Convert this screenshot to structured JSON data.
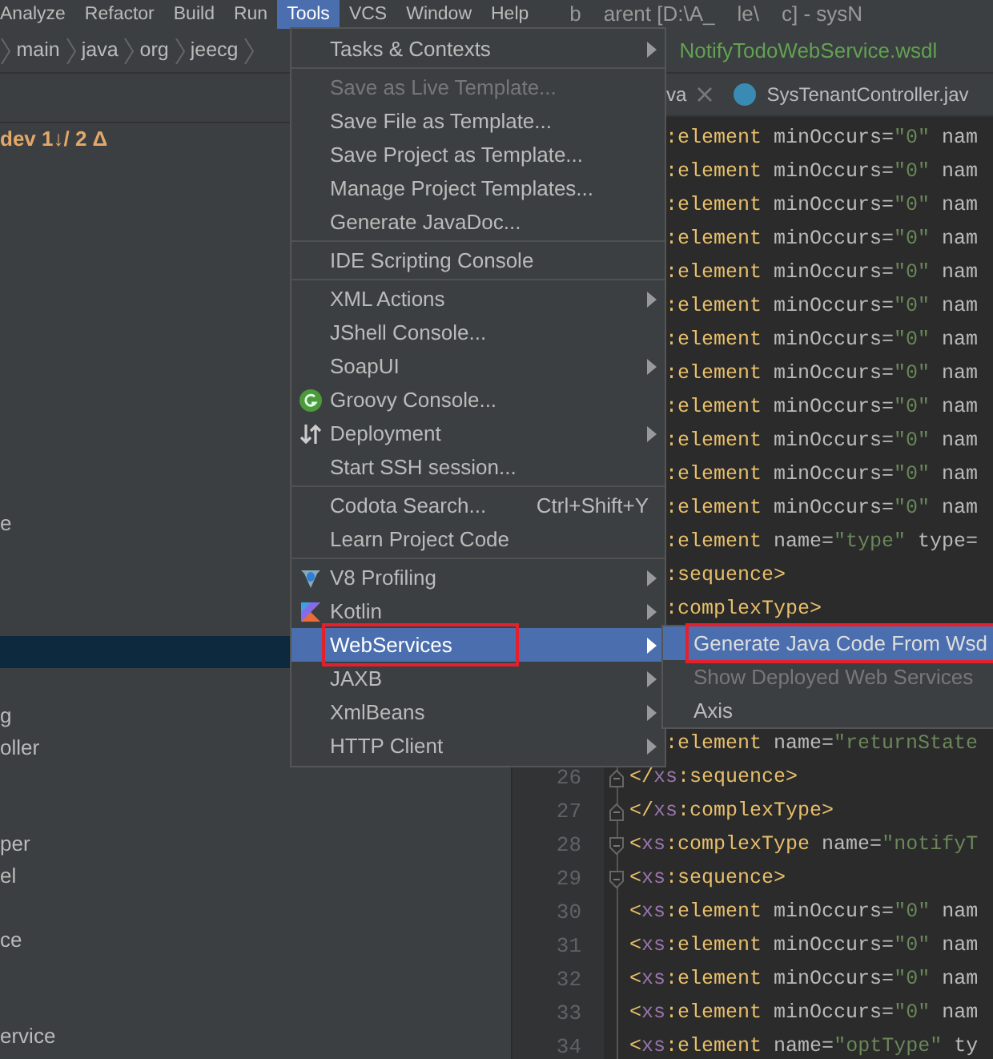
{
  "menubar": {
    "menus": [
      {
        "label": "Analyze",
        "selected": false
      },
      {
        "label": "Refactor",
        "selected": false
      },
      {
        "label": "Build",
        "selected": false
      },
      {
        "label": "Run",
        "selected": false
      },
      {
        "label": "Tools",
        "selected": true
      },
      {
        "label": "VCS",
        "selected": false
      },
      {
        "label": "Window",
        "selected": false
      },
      {
        "label": "Help",
        "selected": false
      }
    ],
    "title_fragments": [
      "b",
      "arent [D:\\A_",
      "le\\",
      "c] - sysN"
    ]
  },
  "breadcrumbs": {
    "items": [
      "main",
      "java",
      "org",
      "jeecg"
    ],
    "file": "NotifyTodoWebService.wsdl"
  },
  "project_tree": {
    "rows": [
      {
        "kind": "text",
        "text": "dev 1↓/ 2 Δ",
        "selected": false
      },
      {
        "kind": "covered",
        "selected": false
      },
      {
        "kind": "covered",
        "selected": false
      },
      {
        "kind": "covered",
        "selected": false
      },
      {
        "kind": "covered",
        "selected": false
      },
      {
        "kind": "covered",
        "selected": false
      },
      {
        "kind": "covered",
        "selected": false
      },
      {
        "kind": "covered",
        "selected": false
      },
      {
        "kind": "covered",
        "selected": false
      },
      {
        "kind": "covered",
        "selected": false
      },
      {
        "kind": "covered",
        "selected": false
      },
      {
        "kind": "covered",
        "selected": false
      },
      {
        "kind": "text",
        "text": "e",
        "selected": false
      },
      {
        "kind": "covered",
        "selected": false
      },
      {
        "kind": "covered",
        "selected": false
      },
      {
        "kind": "covered",
        "selected": false
      },
      {
        "kind": "covered",
        "selected": true
      },
      {
        "kind": "covered",
        "selected": false
      },
      {
        "kind": "text",
        "text": "g",
        "selected": false
      },
      {
        "kind": "text",
        "text": "oller",
        "selected": false
      },
      {
        "kind": "covered",
        "selected": false
      },
      {
        "kind": "covered",
        "selected": false
      },
      {
        "kind": "text",
        "text": "per",
        "selected": false
      },
      {
        "kind": "text",
        "text": "el",
        "selected": false
      },
      {
        "kind": "covered",
        "selected": false
      },
      {
        "kind": "text",
        "text": "ce",
        "selected": false
      },
      {
        "kind": "covered",
        "selected": false
      },
      {
        "kind": "covered",
        "selected": false
      },
      {
        "kind": "text",
        "text": "ervice",
        "selected": false
      }
    ]
  },
  "editor_tabs": [
    {
      "label": "va",
      "closable": true,
      "class_icon": false
    },
    {
      "label": "SysTenantController.jav",
      "closable": false,
      "class_icon": true
    }
  ],
  "code_lines": [
    {
      "kind": "partial",
      "segments": [
        {
          "kind": "tag",
          "text": ":element"
        },
        {
          "kind": "attr",
          "text": " minOccurs="
        },
        {
          "kind": "value",
          "text": "\"0\""
        },
        {
          "kind": "attr",
          "text": " nam"
        }
      ]
    },
    {
      "kind": "partial",
      "segments": [
        {
          "kind": "tag",
          "text": ":element"
        },
        {
          "kind": "attr",
          "text": " minOccurs="
        },
        {
          "kind": "value",
          "text": "\"0\""
        },
        {
          "kind": "attr",
          "text": " nam"
        }
      ]
    },
    {
      "kind": "partial",
      "segments": [
        {
          "kind": "tag",
          "text": ":element"
        },
        {
          "kind": "attr",
          "text": " minOccurs="
        },
        {
          "kind": "value",
          "text": "\"0\""
        },
        {
          "kind": "attr",
          "text": " nam"
        }
      ]
    },
    {
      "kind": "partial",
      "segments": [
        {
          "kind": "tag",
          "text": ":element"
        },
        {
          "kind": "attr",
          "text": " minOccurs="
        },
        {
          "kind": "value",
          "text": "\"0\""
        },
        {
          "kind": "attr",
          "text": " nam"
        }
      ]
    },
    {
      "kind": "partial",
      "segments": [
        {
          "kind": "tag",
          "text": ":element"
        },
        {
          "kind": "attr",
          "text": " minOccurs="
        },
        {
          "kind": "value",
          "text": "\"0\""
        },
        {
          "kind": "attr",
          "text": " nam"
        }
      ]
    },
    {
      "kind": "partial",
      "segments": [
        {
          "kind": "tag",
          "text": ":element"
        },
        {
          "kind": "attr",
          "text": " minOccurs="
        },
        {
          "kind": "value",
          "text": "\"0\""
        },
        {
          "kind": "attr",
          "text": " nam"
        }
      ]
    },
    {
      "kind": "partial",
      "segments": [
        {
          "kind": "tag",
          "text": ":element"
        },
        {
          "kind": "attr",
          "text": " minOccurs="
        },
        {
          "kind": "value",
          "text": "\"0\""
        },
        {
          "kind": "attr",
          "text": " nam"
        }
      ]
    },
    {
      "kind": "partial",
      "segments": [
        {
          "kind": "tag",
          "text": ":element"
        },
        {
          "kind": "attr",
          "text": " minOccurs="
        },
        {
          "kind": "value",
          "text": "\"0\""
        },
        {
          "kind": "attr",
          "text": " nam"
        }
      ]
    },
    {
      "kind": "partial",
      "segments": [
        {
          "kind": "tag",
          "text": ":element"
        },
        {
          "kind": "attr",
          "text": " minOccurs="
        },
        {
          "kind": "value",
          "text": "\"0\""
        },
        {
          "kind": "attr",
          "text": " nam"
        }
      ]
    },
    {
      "kind": "partial",
      "segments": [
        {
          "kind": "tag",
          "text": ":element"
        },
        {
          "kind": "attr",
          "text": " minOccurs="
        },
        {
          "kind": "value",
          "text": "\"0\""
        },
        {
          "kind": "attr",
          "text": " nam"
        }
      ]
    },
    {
      "kind": "partial",
      "segments": [
        {
          "kind": "tag",
          "text": ":element"
        },
        {
          "kind": "attr",
          "text": " minOccurs="
        },
        {
          "kind": "value",
          "text": "\"0\""
        },
        {
          "kind": "attr",
          "text": " nam"
        }
      ]
    },
    {
      "kind": "partial",
      "segments": [
        {
          "kind": "tag",
          "text": ":element"
        },
        {
          "kind": "attr",
          "text": " minOccurs="
        },
        {
          "kind": "value",
          "text": "\"0\""
        },
        {
          "kind": "attr",
          "text": " nam"
        }
      ]
    },
    {
      "kind": "partial",
      "segments": [
        {
          "kind": "tag",
          "text": ":element"
        },
        {
          "kind": "attr",
          "text": " name="
        },
        {
          "kind": "value",
          "text": "\"type\""
        },
        {
          "kind": "attr",
          "text": " type="
        }
      ]
    },
    {
      "kind": "partial",
      "segments": [
        {
          "kind": "tag",
          "text": ":sequence>"
        }
      ]
    },
    {
      "kind": "partial",
      "segments": [
        {
          "kind": "tag",
          "text": ":complexType>"
        }
      ]
    },
    {
      "kind": "covered"
    },
    {
      "kind": "covered"
    },
    {
      "kind": "covered"
    },
    {
      "kind": "partial",
      "segments": [
        {
          "kind": "tag",
          "text": ":element"
        },
        {
          "kind": "attr",
          "text": " name="
        },
        {
          "kind": "value",
          "text": "\"returnState"
        }
      ]
    },
    {
      "kind": "full",
      "number": "26",
      "fold_end": true,
      "segments": [
        {
          "kind": "tag",
          "text": "</"
        },
        {
          "kind": "ns",
          "text": "xs"
        },
        {
          "kind": "tag",
          "text": ":sequence>"
        }
      ]
    },
    {
      "kind": "full",
      "number": "27",
      "fold_end": true,
      "segments": [
        {
          "kind": "tag",
          "text": "</"
        },
        {
          "kind": "ns",
          "text": "xs"
        },
        {
          "kind": "tag",
          "text": ":complexType>"
        }
      ]
    },
    {
      "kind": "full",
      "number": "28",
      "fold_start": true,
      "segments": [
        {
          "kind": "tag",
          "text": "<"
        },
        {
          "kind": "ns",
          "text": "xs"
        },
        {
          "kind": "tag",
          "text": ":complexType"
        },
        {
          "kind": "attr",
          "text": " name="
        },
        {
          "kind": "value",
          "text": "\"notifyT"
        }
      ]
    },
    {
      "kind": "full",
      "number": "29",
      "fold_start": true,
      "segments": [
        {
          "kind": "tag",
          "text": "<"
        },
        {
          "kind": "ns",
          "text": "xs"
        },
        {
          "kind": "tag",
          "text": ":sequence>"
        }
      ]
    },
    {
      "kind": "full",
      "number": "30",
      "segments": [
        {
          "kind": "tag",
          "text": "<"
        },
        {
          "kind": "ns",
          "text": "xs"
        },
        {
          "kind": "tag",
          "text": ":element"
        },
        {
          "kind": "attr",
          "text": " minOccurs="
        },
        {
          "kind": "value",
          "text": "\"0\""
        },
        {
          "kind": "attr",
          "text": " nam"
        }
      ]
    },
    {
      "kind": "full",
      "number": "31",
      "segments": [
        {
          "kind": "tag",
          "text": "<"
        },
        {
          "kind": "ns",
          "text": "xs"
        },
        {
          "kind": "tag",
          "text": ":element"
        },
        {
          "kind": "attr",
          "text": " minOccurs="
        },
        {
          "kind": "value",
          "text": "\"0\""
        },
        {
          "kind": "attr",
          "text": " nam"
        }
      ]
    },
    {
      "kind": "full",
      "number": "32",
      "segments": [
        {
          "kind": "tag",
          "text": "<"
        },
        {
          "kind": "ns",
          "text": "xs"
        },
        {
          "kind": "tag",
          "text": ":element"
        },
        {
          "kind": "attr",
          "text": " minOccurs="
        },
        {
          "kind": "value",
          "text": "\"0\""
        },
        {
          "kind": "attr",
          "text": " nam"
        }
      ]
    },
    {
      "kind": "full",
      "number": "33",
      "segments": [
        {
          "kind": "tag",
          "text": "<"
        },
        {
          "kind": "ns",
          "text": "xs"
        },
        {
          "kind": "tag",
          "text": ":element"
        },
        {
          "kind": "attr",
          "text": " minOccurs="
        },
        {
          "kind": "value",
          "text": "\"0\""
        },
        {
          "kind": "attr",
          "text": " nam"
        }
      ]
    },
    {
      "kind": "full",
      "number": "34",
      "segments": [
        {
          "kind": "tag",
          "text": "<"
        },
        {
          "kind": "ns",
          "text": "xs"
        },
        {
          "kind": "tag",
          "text": ":element"
        },
        {
          "kind": "attr",
          "text": " name="
        },
        {
          "kind": "value",
          "text": "\"optType\""
        },
        {
          "kind": "attr",
          "text": " ty"
        }
      ]
    }
  ],
  "tools_menu": [
    {
      "kind": "item",
      "label": "Tasks & Contexts",
      "submenu": true,
      "disabled": false,
      "selected": false,
      "boxed": false,
      "has_icon": false
    },
    {
      "kind": "separator"
    },
    {
      "kind": "item",
      "label": "Save as Live Template...",
      "submenu": false,
      "disabled": true,
      "selected": false,
      "boxed": false,
      "has_icon": false
    },
    {
      "kind": "item",
      "label": "Save File as Template...",
      "submenu": false,
      "disabled": false,
      "selected": false,
      "boxed": false,
      "has_icon": false
    },
    {
      "kind": "item",
      "label": "Save Project as Template...",
      "submenu": false,
      "disabled": false,
      "selected": false,
      "boxed": false,
      "has_icon": false
    },
    {
      "kind": "item",
      "label": "Manage Project Templates...",
      "submenu": false,
      "disabled": false,
      "selected": false,
      "boxed": false,
      "has_icon": false
    },
    {
      "kind": "item",
      "label": "Generate JavaDoc...",
      "submenu": false,
      "disabled": false,
      "selected": false,
      "boxed": false,
      "has_icon": false
    },
    {
      "kind": "separator"
    },
    {
      "kind": "item",
      "label": "IDE Scripting Console",
      "submenu": false,
      "disabled": false,
      "selected": false,
      "boxed": false,
      "has_icon": false
    },
    {
      "kind": "separator"
    },
    {
      "kind": "item",
      "label": "XML Actions",
      "submenu": true,
      "disabled": false,
      "selected": false,
      "boxed": false,
      "has_icon": false
    },
    {
      "kind": "item",
      "label": "JShell Console...",
      "submenu": false,
      "disabled": false,
      "selected": false,
      "boxed": false,
      "has_icon": false
    },
    {
      "kind": "item",
      "label": "SoapUI",
      "submenu": true,
      "disabled": false,
      "selected": false,
      "boxed": false,
      "has_icon": false
    },
    {
      "kind": "item",
      "label": "Groovy Console...",
      "submenu": false,
      "disabled": false,
      "selected": false,
      "boxed": false,
      "has_icon": true
    },
    {
      "kind": "item",
      "label": "Deployment",
      "submenu": true,
      "disabled": false,
      "selected": false,
      "boxed": false,
      "has_icon": true
    },
    {
      "kind": "item",
      "label": "Start SSH session...",
      "submenu": false,
      "disabled": false,
      "selected": false,
      "boxed": false,
      "has_icon": false
    },
    {
      "kind": "separator"
    },
    {
      "kind": "item",
      "label": "Codota Search...",
      "shortcut": "Ctrl+Shift+Y",
      "submenu": false,
      "disabled": false,
      "selected": false,
      "boxed": false,
      "has_icon": false
    },
    {
      "kind": "item",
      "label": "Learn Project Code",
      "submenu": false,
      "disabled": false,
      "selected": false,
      "boxed": false,
      "has_icon": false
    },
    {
      "kind": "separator"
    },
    {
      "kind": "item",
      "label": "V8 Profiling",
      "submenu": true,
      "disabled": false,
      "selected": false,
      "boxed": false,
      "has_icon": true
    },
    {
      "kind": "item",
      "label": "Kotlin",
      "submenu": true,
      "disabled": false,
      "selected": false,
      "boxed": false,
      "has_icon": true
    },
    {
      "kind": "item",
      "label": "WebServices",
      "submenu": true,
      "disabled": false,
      "selected": true,
      "boxed": true,
      "has_icon": false
    },
    {
      "kind": "item",
      "label": "JAXB",
      "submenu": true,
      "disabled": false,
      "selected": false,
      "boxed": false,
      "has_icon": false
    },
    {
      "kind": "item",
      "label": "XmlBeans",
      "submenu": true,
      "disabled": false,
      "selected": false,
      "boxed": false,
      "has_icon": false
    },
    {
      "kind": "item",
      "label": "HTTP Client",
      "submenu": true,
      "disabled": false,
      "selected": false,
      "boxed": false,
      "has_icon": false
    }
  ],
  "webservices_submenu": [
    {
      "label": "Generate Java Code From Wsd",
      "disabled": false,
      "selected": true,
      "boxed": true
    },
    {
      "label": "Show Deployed Web Services",
      "disabled": true,
      "selected": false,
      "boxed": false
    },
    {
      "label": "Axis",
      "disabled": false,
      "selected": false,
      "boxed": false
    }
  ]
}
